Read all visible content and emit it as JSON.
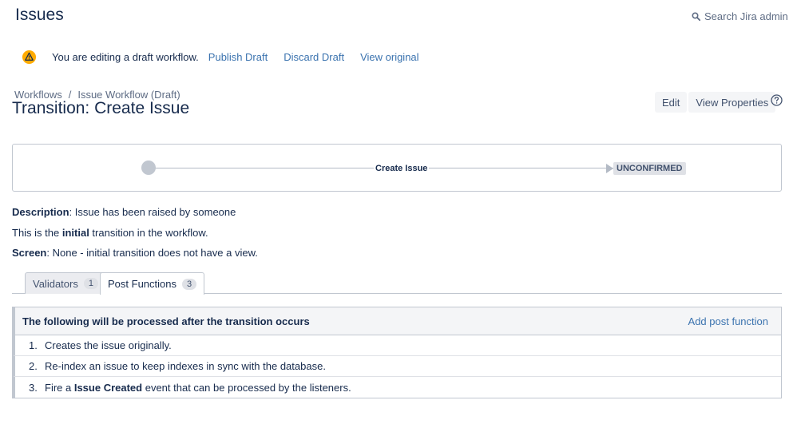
{
  "header": {
    "title": "Issues",
    "search_label": "Search Jira admin"
  },
  "draft_bar": {
    "icon": "warning-icon",
    "message": "You are editing a draft workflow.",
    "publish": "Publish Draft",
    "discard": "Discard Draft",
    "view_original": "View original"
  },
  "breadcrumb": {
    "items": [
      "Workflows",
      "Issue Workflow (Draft)"
    ],
    "separator": "/"
  },
  "page_title": "Transition: Create Issue",
  "actions": {
    "edit": "Edit",
    "view_properties": "View Properties",
    "help_icon": "help-icon"
  },
  "diagram": {
    "transition_name": "Create Issue",
    "target_status": "UNCONFIRMED"
  },
  "info": {
    "description_label": "Description",
    "description_text": ": Issue has been raised by someone",
    "initial_prefix": "This is the ",
    "initial_bold": "initial",
    "initial_suffix": " transition in the workflow.",
    "screen_label": "Screen",
    "screen_text": ": None - initial transition does not have a view."
  },
  "tabs": [
    {
      "label": "Validators",
      "count": "1"
    },
    {
      "label": "Post Functions",
      "count": "3"
    }
  ],
  "post_functions": {
    "heading": "The following will be processed after the transition occurs",
    "add_label": "Add post function",
    "items": [
      {
        "num": "1.",
        "text": "Creates the issue originally."
      },
      {
        "num": "2.",
        "text": "Re-index an issue to keep indexes in sync with the database."
      },
      {
        "num": "3.",
        "prefix": "Fire a ",
        "bold": "Issue Created",
        "suffix": " event that can be processed by the listeners."
      }
    ]
  },
  "colors": {
    "link": "#3b73af",
    "warning": "#ffab00",
    "text": "#172b4d"
  }
}
